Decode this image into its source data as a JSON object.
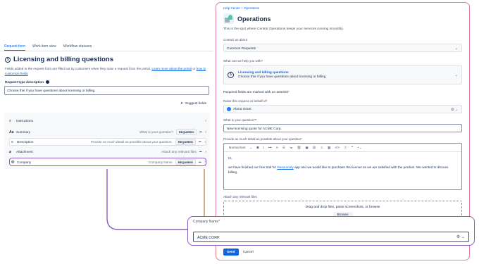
{
  "left": {
    "tabs": [
      "Request form",
      "Work item view",
      "Workflow statuses"
    ],
    "title": "Licensing and billing questions",
    "description_pre": "Fields added to the request form are filled out by customers when they raise a request from the portal. ",
    "link1": "Learn more about the portal",
    "description_mid": " or ",
    "link2": "how to customize fields",
    "rtd_label": "Request type description",
    "rtd_value": "Choose this if you have questions about licensing or billing.",
    "suggest": "Suggest fields",
    "fields": [
      {
        "icon": "≡",
        "name": "Instructions",
        "hint": "",
        "required": "",
        "boxed": false
      },
      {
        "icon": "Aa",
        "name": "Summary",
        "hint": "What is your question?",
        "required": "REQUIRED",
        "boxed": false
      },
      {
        "icon": "≡",
        "name": "Description",
        "hint": "Provide as much detail as possible about your question.",
        "required": "REQUIRED",
        "boxed": true
      },
      {
        "icon": "⌀",
        "name": "Attachment",
        "hint": "Attach any relevant files",
        "required": "",
        "boxed": false
      },
      {
        "icon": "◎",
        "name": "Company",
        "hint": "Company Name",
        "required": "REQUIRED",
        "boxed": true
      }
    ]
  },
  "right": {
    "breadcrumb_home": "Help Center",
    "breadcrumb_sep": "/",
    "breadcrumb_current": "Operations",
    "title": "Operations",
    "subtitle": "This is the spot where Central Operations keeps your services running smoothly.",
    "contact_label": "Contact us about",
    "contact_value": "Common Requests",
    "help_label": "What can we help you with?",
    "help_title": "Licensing and billing questions",
    "help_desc": "Choose this if you have questions about licensing or billing.",
    "required_note": "Required fields are marked with an asterisk",
    "raise_label": "Raise this request on behalf of",
    "raise_value": "Alana Grant",
    "question_label": "What is your question?",
    "question_value": "New licensing quote for ACME Corp.",
    "detail_label": "Provide as much detail as possible about your question",
    "toolbar_style": "Normal text",
    "body_hi": "Hi,",
    "body_pre": "we have finished our free trial for ",
    "body_link": "Resourcely",
    "body_post": " app and we would like to purchase the license as we are satisfied with the product. We wanted to discuss billing.",
    "attach_label": "Attach any relevant files",
    "drop_text": "Drag and drop files, paste screenshots, or browse",
    "browse": "Browse",
    "send": "Send",
    "cancel": "Cancel"
  },
  "overlay": {
    "label": "Company Name",
    "value": "ACME CORP."
  },
  "colors": {
    "accent": "#0c66e4",
    "highlight_purple": "#8b5cc4",
    "panel_border": "#e87a9b",
    "connector": "#b07a3c"
  }
}
